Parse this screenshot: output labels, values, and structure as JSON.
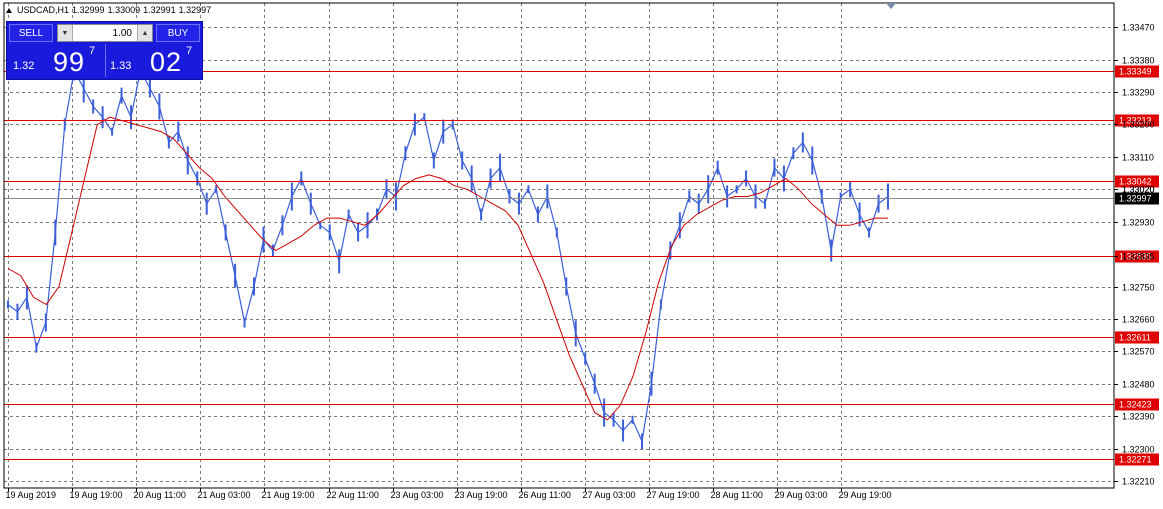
{
  "header": {
    "symbol": "USDCAD,H1",
    "open": "1.32999",
    "high": "1.33009",
    "low": "1.32991",
    "close": "1.32997"
  },
  "trade_panel": {
    "sell_label": "SELL",
    "buy_label": "BUY",
    "lot": "1.00",
    "sell_price_small": "1.32",
    "sell_price_big": "99",
    "sell_price_sup": "7",
    "buy_price_small": "1.33",
    "buy_price_big": "02",
    "buy_price_sup": "7"
  },
  "colors": {
    "candle": "#3b5fd9",
    "ma": "#cc0000",
    "level": "#e00000",
    "grid": "#7a7a7a",
    "current_label_bg": "#000000"
  },
  "chart_data": {
    "type": "line",
    "symbol": "USDCAD",
    "timeframe": "H1",
    "ylim": [
      1.3221,
      1.3349
    ],
    "y_ticks": [
      "1.33470",
      "1.33380",
      "1.33290",
      "1.33200",
      "1.33110",
      "1.33020",
      "1.32930",
      "1.32835",
      "1.32750",
      "1.32660",
      "1.32570",
      "1.32480",
      "1.32390",
      "1.32300",
      "1.32210"
    ],
    "x_ticks": [
      "19 Aug 2019",
      "19 Aug 19:00",
      "20 Aug 11:00",
      "21 Aug 03:00",
      "21 Aug 19:00",
      "22 Aug 11:00",
      "23 Aug 03:00",
      "23 Aug 19:00",
      "26 Aug 11:00",
      "27 Aug 03:00",
      "27 Aug 19:00",
      "28 Aug 11:00",
      "29 Aug 03:00",
      "29 Aug 19:00"
    ],
    "horizontal_levels": [
      "1.33349",
      "1.33213",
      "1.33042",
      "1.32835",
      "1.32611",
      "1.32423",
      "1.32271"
    ],
    "current_price": "1.32997",
    "hidden_label": "1.33020",
    "series": [
      {
        "values": [
          1.327,
          1.3268,
          1.3272,
          1.3258,
          1.3265,
          1.329,
          1.332,
          1.3335,
          1.333,
          1.3325,
          1.3322,
          1.3318,
          1.3328,
          1.3322,
          1.3335,
          1.333,
          1.3325,
          1.3315,
          1.3318,
          1.331,
          1.3305,
          1.3298,
          1.3302,
          1.329,
          1.3278,
          1.3265,
          1.3275,
          1.3288,
          1.3285,
          1.3292,
          1.33,
          1.3305,
          1.3298,
          1.3292,
          1.329,
          1.3282,
          1.3295,
          1.329,
          1.3292,
          1.3295,
          1.3302,
          1.33,
          1.3312,
          1.332,
          1.3322,
          1.331,
          1.3318,
          1.332,
          1.331,
          1.3305,
          1.3295,
          1.3305,
          1.3308,
          1.33,
          1.3298,
          1.3302,
          1.3295,
          1.33,
          1.329,
          1.3275,
          1.3262,
          1.3255,
          1.3248,
          1.324,
          1.3238,
          1.3235,
          1.3238,
          1.3232,
          1.3248,
          1.327,
          1.3285,
          1.3292,
          1.33,
          1.3298,
          1.3302,
          1.3308,
          1.33,
          1.3302,
          1.3305,
          1.33,
          1.3298,
          1.3308,
          1.3305,
          1.3312,
          1.3315,
          1.331,
          1.33,
          1.3285,
          1.33,
          1.3302,
          1.3295,
          1.329,
          1.3298,
          1.33
        ]
      },
      {
        "values": [
          1.328,
          1.3278,
          1.3272,
          1.327,
          1.3275,
          1.329,
          1.3305,
          1.332,
          1.3322,
          1.3321,
          1.332,
          1.3319,
          1.3318,
          1.3316,
          1.3312,
          1.3308,
          1.3305,
          1.33,
          1.3296,
          1.3292,
          1.3288,
          1.3285,
          1.3287,
          1.3289,
          1.3292,
          1.3294,
          1.3294,
          1.3293,
          1.3292,
          1.3295,
          1.3299,
          1.3303,
          1.3305,
          1.3306,
          1.3305,
          1.3303,
          1.3302,
          1.33,
          1.3298,
          1.3296,
          1.3292,
          1.3284,
          1.3276,
          1.3266,
          1.3256,
          1.3248,
          1.324,
          1.3238,
          1.3242,
          1.325,
          1.3262,
          1.3276,
          1.3286,
          1.3292,
          1.3295,
          1.3297,
          1.3299,
          1.33,
          1.33,
          1.3301,
          1.3303,
          1.3305,
          1.3302,
          1.3298,
          1.3295,
          1.3292,
          1.3292,
          1.3293,
          1.3294,
          1.3294
        ]
      }
    ]
  }
}
